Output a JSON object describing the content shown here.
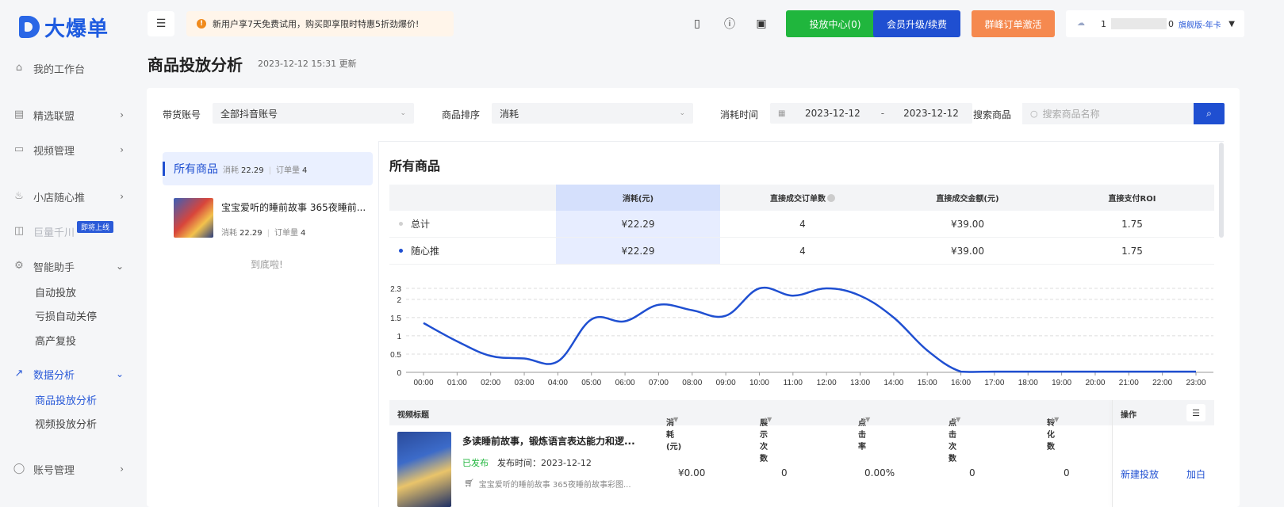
{
  "brand": {
    "logo_text": "大爆单"
  },
  "sidebar": {
    "items": [
      {
        "label": "我的工作台",
        "icon": "home-icon"
      },
      {
        "label": "精选联盟",
        "icon": "store-icon"
      },
      {
        "label": "视频管理",
        "icon": "video-icon"
      },
      {
        "label": "小店随心推",
        "icon": "flame-icon"
      },
      {
        "label": "巨量千川",
        "icon": "chart-icon",
        "badge": "即将上线"
      },
      {
        "label": "智能助手",
        "icon": "robot-icon"
      },
      {
        "label": "数据分析",
        "icon": "trend-icon"
      },
      {
        "label": "账号管理",
        "icon": "user-icon"
      }
    ],
    "assistant_sub": [
      "自动投放",
      "亏损自动关停",
      "高产复投"
    ],
    "analysis_sub": [
      "商品投放分析",
      "视频投放分析"
    ]
  },
  "topbar": {
    "notice": "新用户享7天免费试用，购买即享限时特惠5折劲爆价!",
    "btn_delivery": "投放中心(0)",
    "btn_upgrade": "会员升级/续费",
    "btn_activate": "群峰订单激活",
    "account_name": "1",
    "account_suffix": "0",
    "account_plan": "旗舰版-年卡"
  },
  "page": {
    "title": "商品投放分析",
    "updated": "2023-12-12 15:31 更新"
  },
  "filters": {
    "account_label": "带货账号",
    "account_value": "全部抖音账号",
    "sort_label": "商品排序",
    "sort_value": "消耗",
    "time_label": "消耗时间",
    "date_start": "2023-12-12",
    "date_sep": "-",
    "date_end": "2023-12-12",
    "search_label": "搜索商品",
    "search_placeholder": "搜索商品名称"
  },
  "product_list": {
    "all": {
      "name": "所有商品",
      "cost_label": "消耗",
      "cost": "22.29",
      "orders_label": "订单量",
      "orders": "4"
    },
    "items": [
      {
        "title": "宝宝爱听的睡前故事 365夜睡前...",
        "cost_label": "消耗",
        "cost": "22.29",
        "orders_label": "订单量",
        "orders": "4"
      }
    ],
    "end_text": "到底啦!"
  },
  "summary": {
    "title": "所有商品",
    "headers": [
      "",
      "消耗(元)",
      "直接成交订单数",
      "直接成交金额(元)",
      "直接支付ROI"
    ],
    "rows": [
      {
        "label": "总计",
        "cost": "¥22.29",
        "orders": "4",
        "amount": "¥39.00",
        "roi": "1.75",
        "dot_color": "#d0d0d0"
      },
      {
        "label": "随心推",
        "cost": "¥22.29",
        "orders": "4",
        "amount": "¥39.00",
        "roi": "1.75",
        "dot_color": "#1f4fd1"
      }
    ]
  },
  "chart_data": {
    "type": "line",
    "x": [
      "00:00",
      "01:00",
      "02:00",
      "03:00",
      "04:00",
      "05:00",
      "06:00",
      "07:00",
      "08:00",
      "09:00",
      "10:00",
      "11:00",
      "12:00",
      "13:00",
      "14:00",
      "15:00",
      "16:00",
      "17:00",
      "18:00",
      "19:00",
      "20:00",
      "21:00",
      "22:00",
      "23:00"
    ],
    "series": [
      {
        "values": [
          1.35,
          0.85,
          0.45,
          0.38,
          0.3,
          1.45,
          1.4,
          1.85,
          1.7,
          1.55,
          2.3,
          2.1,
          2.3,
          2.1,
          1.5,
          0.6,
          0.02,
          0.02,
          0.02,
          0.02,
          0.02,
          0.02,
          0.02,
          0.02
        ]
      }
    ],
    "yticks": [
      "0",
      "0.5",
      "1",
      "1.5",
      "2",
      "2.3"
    ],
    "ylim": [
      0,
      2.3
    ],
    "grid": true,
    "color": "#1f4fd1"
  },
  "video_table": {
    "headers": [
      "视频标题",
      "消耗(元)",
      "展示次数",
      "点击率",
      "点击次数",
      "转化数",
      "操作"
    ],
    "rows": [
      {
        "title": "多读睡前故事，锻炼语言表达能力和逻...",
        "status": "已发布",
        "publish": "发布时间：2023-12-12",
        "product": "宝宝爱听的睡前故事 365夜睡前故事彩图...",
        "cost": "¥0.00",
        "views": "0",
        "ctr": "0.00%",
        "clicks": "0",
        "conversions": "0",
        "action_new": "新建投放",
        "action_add": "加白"
      }
    ]
  }
}
